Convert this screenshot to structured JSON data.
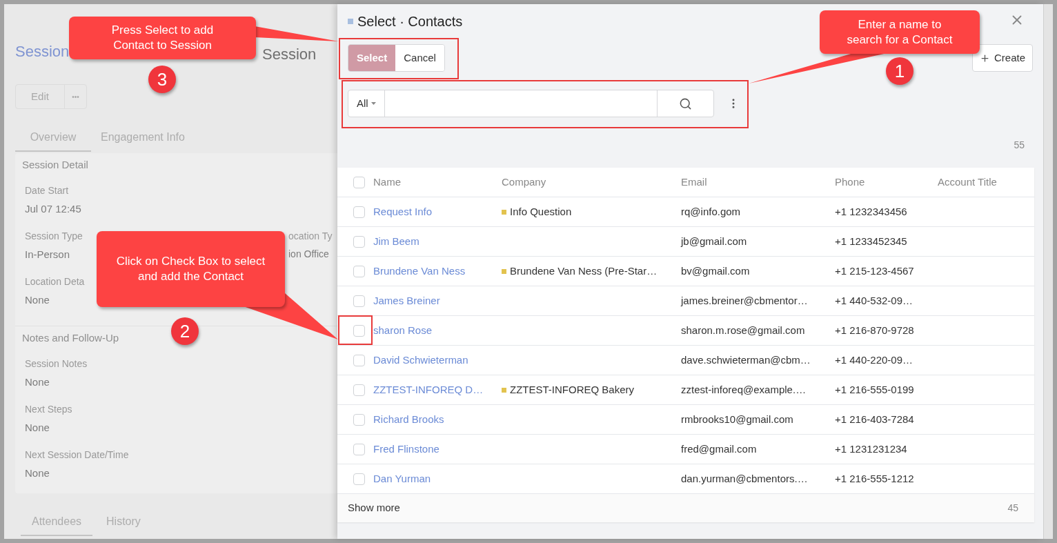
{
  "background_page": {
    "title": "Session",
    "title_2": "Session",
    "actions": [
      {
        "kind": "text",
        "label": "Edit"
      },
      {
        "kind": "more",
        "label": "•••"
      }
    ],
    "tabs": [
      {
        "label": "Overview",
        "selected": true
      },
      {
        "label": "Engagement Info",
        "selected": false
      }
    ],
    "sections": [
      {
        "title": "Session Detail",
        "fields": [
          {
            "label": "Date Start",
            "value": "Jul 07 12:45"
          },
          {
            "label": "Session Type",
            "value": "In-Person",
            "label_2": "ocation Ty",
            "value_2": "ion Office"
          },
          {
            "label": "Location Deta",
            "value": "None"
          }
        ]
      },
      {
        "title": "Notes and Follow-Up",
        "fields": [
          {
            "label": "Session Notes",
            "value": "None"
          },
          {
            "label": "Next Steps",
            "value": "None"
          },
          {
            "label": "Next Session Date/Time",
            "value": "None"
          }
        ]
      }
    ],
    "bottom_tabs": [
      {
        "label": "Attendees",
        "selected": true
      },
      {
        "label": "History",
        "selected": false
      }
    ]
  },
  "drawer": {
    "title": "Select · Contacts",
    "buttons": [
      {
        "label": "Select",
        "kind": "primary"
      },
      {
        "label": "Cancel",
        "kind": "secondary"
      }
    ],
    "create_button": "Create",
    "search": {
      "filter": "All"
    },
    "count": "55",
    "table": {
      "select_all": {
        "checked": false
      },
      "columns": [
        "Name",
        "Company",
        "Email",
        "Phone",
        "Account Title"
      ],
      "rows": [
        {
          "checked": false,
          "name": "Request Info",
          "company": "Info Question",
          "color": "#e2c34f",
          "email": "rq@info.gom",
          "phone": "+1 1232343456"
        },
        {
          "checked": false,
          "name": "Jim Beem",
          "email": "jb@gmail.com",
          "phone": "+1 1233452345"
        },
        {
          "checked": false,
          "name": "Brundene Van Ness",
          "company": "Brundene Van Ness (Pre-Star…",
          "color": "#e2c34f",
          "email": "bv@gmail.com",
          "phone": "+1 215-123-4567"
        },
        {
          "checked": false,
          "name": "James Breiner",
          "email": "james.breiner@cbmentor…",
          "phone": "+1 440-532-09…"
        },
        {
          "checked": false,
          "name": "sharon Rose",
          "email": "sharon.m.rose@gmail.com",
          "phone": "+1 216-870-9728"
        },
        {
          "checked": false,
          "name": "David Schwieterman",
          "email": "dave.schwieterman@cbm…",
          "phone": "+1 440-220-09…"
        },
        {
          "checked": false,
          "name": "ZZTEST-INFOREQ D…",
          "company": "ZZTEST-INFOREQ Bakery",
          "color": "#e2c34f",
          "email": "zztest-inforeq@example.…",
          "phone": "+1 216-555-0199"
        },
        {
          "checked": false,
          "name": "Richard Brooks",
          "email": "rmbrooks10@gmail.com",
          "phone": "+1 216-403-7284"
        },
        {
          "checked": false,
          "name": "Fred Flinstone",
          "email": "fred@gmail.com",
          "phone": "+1 1231231234"
        },
        {
          "checked": false,
          "name": "Dan Yurman",
          "email": "dan.yurman@cbmentors.…",
          "phone": "+1 216-555-1212"
        }
      ],
      "show_more": "Show more",
      "footer_count": "45"
    }
  },
  "callouts": [
    {
      "number": "3",
      "text": "Press Select to add Contact to Session"
    },
    {
      "number": "1",
      "text": "Enter a name to search for a Contact"
    },
    {
      "number": "2",
      "text": "Click on Check Box to select and add the Contact"
    }
  ]
}
